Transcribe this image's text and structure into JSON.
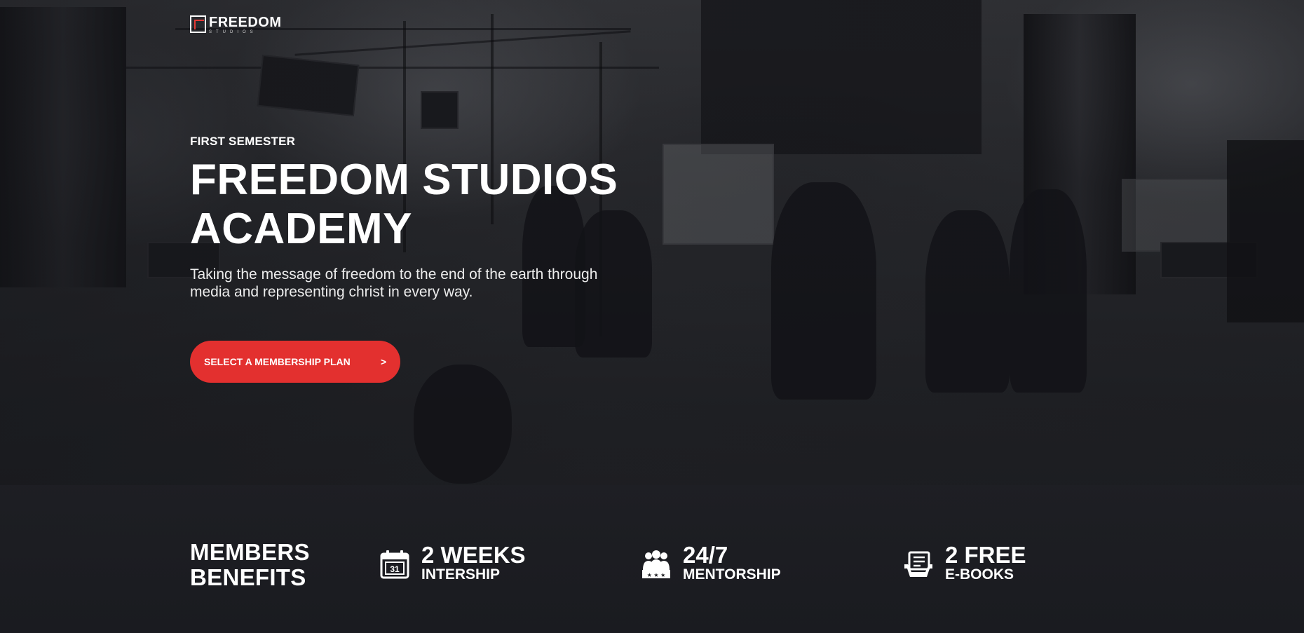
{
  "brand": {
    "name": "FREEDOM",
    "sub": "STUDIOS",
    "accent": "#e3302f"
  },
  "hero": {
    "eyebrow": "FIRST SEMESTER",
    "title_line1": "FREEDOM STUDIOS",
    "title_line2": "ACADEMY",
    "tagline_line1": "Taking the message of freedom to the end of the earth through",
    "tagline_line2": "media and representing christ in every way.",
    "cta_label": "SELECT A MEMBERSHIP PLAN",
    "cta_arrow": ">"
  },
  "benefits": {
    "title_line1": "MEMBERS",
    "title_line2": "BENEFITS",
    "items": [
      {
        "icon": "calendar-icon",
        "value": "2 WEEKS",
        "label": "INTERSHIP",
        "icon_text": "31"
      },
      {
        "icon": "team-icon",
        "value": "24/7",
        "label": "MENTORSHIP"
      },
      {
        "icon": "ebook-icon",
        "value": "2 FREE",
        "label": "E-BOOKS"
      }
    ]
  }
}
